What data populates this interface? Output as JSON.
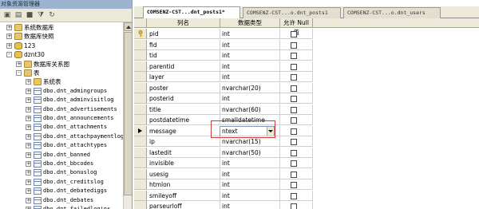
{
  "explorer": {
    "title": "对象资源管理器",
    "tree": [
      {
        "label": "系统数据库",
        "icon": "folder-icon",
        "indent": 0,
        "expander": "+"
      },
      {
        "label": "数据库快照",
        "icon": "folder-icon",
        "indent": 0,
        "expander": "+"
      },
      {
        "label": "123",
        "icon": "database-icon",
        "indent": 0,
        "expander": "+"
      },
      {
        "label": "dznt30",
        "icon": "database-icon",
        "indent": 0,
        "expander": "-"
      },
      {
        "label": "数据库关系图",
        "icon": "folder-icon",
        "indent": 1,
        "expander": "+"
      },
      {
        "label": "表",
        "icon": "folder-icon",
        "indent": 1,
        "expander": "-"
      },
      {
        "label": "系统表",
        "icon": "folder-icon",
        "indent": 2,
        "expander": "+"
      },
      {
        "label": "dbo.dnt_admingroups",
        "icon": "table-icon",
        "indent": 2,
        "expander": "+"
      },
      {
        "label": "dbo.dnt_adminvisitlog",
        "icon": "table-icon",
        "indent": 2,
        "expander": "+"
      },
      {
        "label": "dbo.dnt_advertisements",
        "icon": "table-icon",
        "indent": 2,
        "expander": "+"
      },
      {
        "label": "dbo.dnt_announcements",
        "icon": "table-icon",
        "indent": 2,
        "expander": "+"
      },
      {
        "label": "dbo.dnt_attachments",
        "icon": "table-icon",
        "indent": 2,
        "expander": "+"
      },
      {
        "label": "dbo.dnt_attachpaymentlog",
        "icon": "table-icon",
        "indent": 2,
        "expander": "+"
      },
      {
        "label": "dbo.dnt_attachtypes",
        "icon": "table-icon",
        "indent": 2,
        "expander": "+"
      },
      {
        "label": "dbo.dnt_banned",
        "icon": "table-icon",
        "indent": 2,
        "expander": "+"
      },
      {
        "label": "dbo.dnt_bbcodes",
        "icon": "table-icon",
        "indent": 2,
        "expander": "+"
      },
      {
        "label": "dbo.dnt_bonuslog",
        "icon": "table-icon",
        "indent": 2,
        "expander": "+"
      },
      {
        "label": "dbo.dnt_creditslog",
        "icon": "table-icon",
        "indent": 2,
        "expander": "+"
      },
      {
        "label": "dbo.dnt_debatediggs",
        "icon": "table-icon",
        "indent": 2,
        "expander": "+"
      },
      {
        "label": "dbo.dnt_debates",
        "icon": "table-icon",
        "indent": 2,
        "expander": "+"
      },
      {
        "label": "dbo.dnt_failedlogins",
        "icon": "table-icon",
        "indent": 2,
        "expander": "+"
      }
    ]
  },
  "tabs": [
    {
      "label": "COMSENZ-CST...dnt_posts1*",
      "active": true
    },
    {
      "label": "COMSENZ-CST...o.dnt_posts1",
      "active": false
    },
    {
      "label": "COMSENZ-CST...o.dnt_users",
      "active": false
    }
  ],
  "grid": {
    "headers": {
      "name": "列名",
      "type": "数据类型",
      "nullable": "允许 Null 值"
    },
    "rows": [
      {
        "name": "pid",
        "type": "int",
        "key": true
      },
      {
        "name": "fid",
        "type": "int"
      },
      {
        "name": "tid",
        "type": "int"
      },
      {
        "name": "parentid",
        "type": "int"
      },
      {
        "name": "layer",
        "type": "int"
      },
      {
        "name": "poster",
        "type": "nvarchar(20)"
      },
      {
        "name": "posterid",
        "type": "int"
      },
      {
        "name": "title",
        "type": "nvarchar(60)"
      },
      {
        "name": "postdatetime",
        "type": "smalldatetime"
      },
      {
        "name": "message",
        "type": "ntext",
        "editing": true,
        "current": true
      },
      {
        "name": "ip",
        "type": "nvarchar(15)"
      },
      {
        "name": "lastedit",
        "type": "nvarchar(50)"
      },
      {
        "name": "invisible",
        "type": "int"
      },
      {
        "name": "usesig",
        "type": "int"
      },
      {
        "name": "htmlon",
        "type": "int"
      },
      {
        "name": "smileyoff",
        "type": "int"
      },
      {
        "name": "parseurloff",
        "type": "int"
      }
    ]
  }
}
